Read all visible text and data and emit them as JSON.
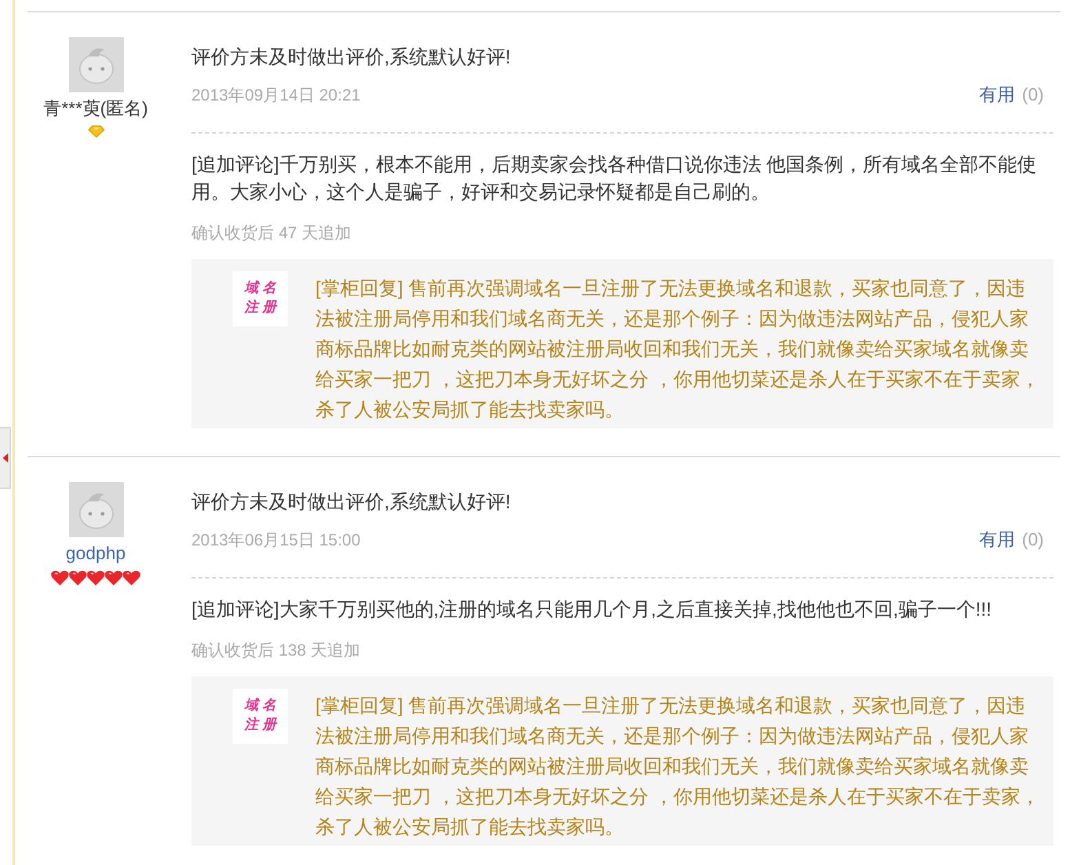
{
  "reviews": [
    {
      "reviewer": {
        "name": "青***萸(匿名)",
        "anonymous": true
      },
      "credit_badges": [
        {
          "kind": "diamond"
        }
      ],
      "comment": "评价方未及时做出评价,系统默认好评!",
      "date": "2013年09月14日 20:21",
      "helpful": {
        "label": "有用",
        "count": "(0)"
      },
      "follow_up": {
        "text": "[追加评论]千万别买，根本不能用，后期卖家会找各种借口说你违法 他国条例，所有域名全部不能使用。大家小心，这个人是骗子，好评和交易记录怀疑都是自己刷的。",
        "note": "确认收货后 47 天追加"
      },
      "reply": {
        "logo_lines": [
          "域名",
          "注册"
        ],
        "text": "[掌柜回复] 售前再次强调域名一旦注册了无法更换域名和退款，买家也同意了，因违法被注册局停用和我们域名商无关，还是那个例子：因为做违法网站产品，侵犯人家商标品牌比如耐克类的网站被注册局收回和我们无关，我们就像卖给买家域名就像卖给买家一把刀 ，这把刀本身无好坏之分 ，你用他切菜还是杀人在于买家不在于卖家，杀了人被公安局抓了能去找卖家吗。"
      }
    },
    {
      "reviewer": {
        "name": "godphp",
        "anonymous": false
      },
      "credit_badges": [
        {
          "kind": "heart"
        },
        {
          "kind": "heart"
        },
        {
          "kind": "heart"
        },
        {
          "kind": "heart"
        },
        {
          "kind": "heart"
        }
      ],
      "comment": "评价方未及时做出评价,系统默认好评!",
      "date": "2013年06月15日 15:00",
      "helpful": {
        "label": "有用",
        "count": "(0)"
      },
      "follow_up": {
        "text": "[追加评论]大家千万别买他的,注册的域名只能用几个月,之后直接关掉,找他他也不回,骗子一个!!!",
        "note": "确认收货后 138 天追加"
      },
      "reply": {
        "logo_lines": [
          "域名",
          "注册"
        ],
        "text": "[掌柜回复] 售前再次强调域名一旦注册了无法更换域名和退款，买家也同意了，因违法被注册局停用和我们域名商无关，还是那个例子：因为做违法网站产品，侵犯人家商标品牌比如耐克类的网站被注册局收回和我们无关，我们就像卖给买家域名就像卖给买家一把刀 ，这把刀本身无好坏之分 ，你用他切菜还是杀人在于买家不在于卖家，杀了人被公安局抓了能去找卖家吗。"
      }
    }
  ]
}
